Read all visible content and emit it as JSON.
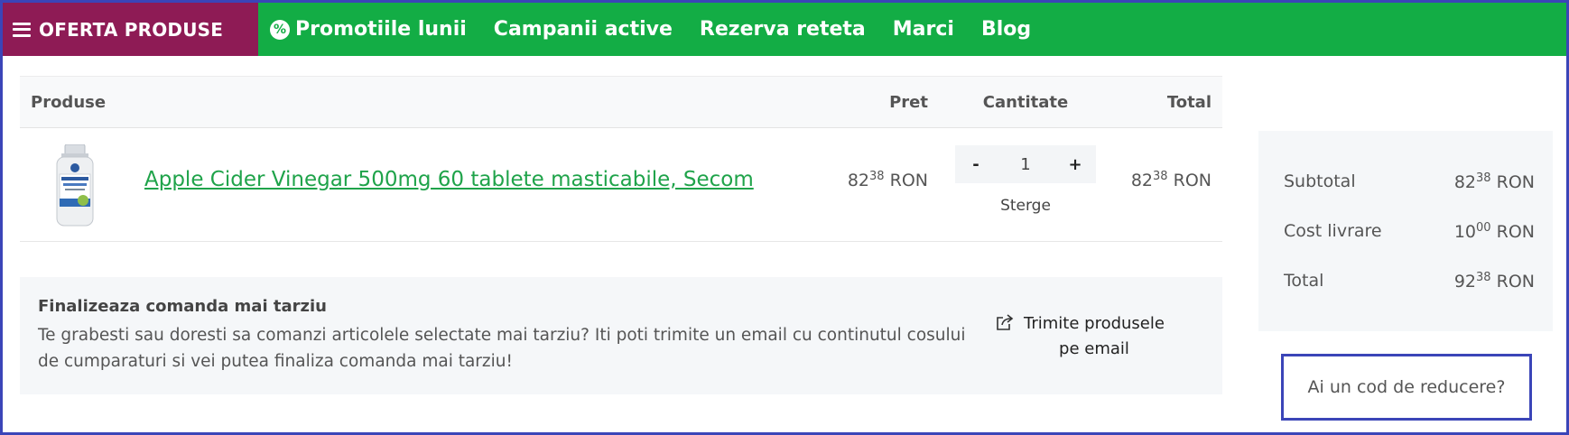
{
  "nav": {
    "offer_label": "OFERTA PRODUSE",
    "links": [
      "Promotiile lunii",
      "Campanii active",
      "Rezerva reteta",
      "Marci",
      "Blog"
    ],
    "promo_icon_glyph": "%"
  },
  "cart": {
    "headers": {
      "product": "Produse",
      "price": "Pret",
      "quantity": "Cantitate",
      "total": "Total"
    },
    "items": [
      {
        "name": "Apple Cider Vinegar 500mg 60 tablete masticabile, Secom",
        "image_label": "Apple Cider Vinegar",
        "price_int": "82",
        "price_dec": "38",
        "currency": "RON",
        "quantity": "1",
        "minus": "-",
        "plus": "+",
        "remove_label": "Sterge",
        "total_int": "82",
        "total_dec": "38"
      }
    ]
  },
  "later": {
    "title": "Finalizeaza comanda mai tarziu",
    "text": "Te grabesti sau doresti sa comanzi articolele selectate mai tarziu? Iti poti trimite un email cu continutul cosului de cumparaturi si vei putea finaliza comanda mai tarziu!",
    "send_label_1": "Trimite produsele",
    "send_label_2": "pe email"
  },
  "summary": {
    "subtotal_label": "Subtotal",
    "subtotal_int": "82",
    "subtotal_dec": "38",
    "shipping_label": "Cost livrare",
    "shipping_int": "10",
    "shipping_dec": "00",
    "total_label": "Total",
    "total_int": "92",
    "total_dec": "38",
    "currency": "RON"
  },
  "coupon": {
    "label": "Ai un cod de reducere?"
  },
  "colors": {
    "nav_green": "#13ad45",
    "offer_purple": "#8e1b55",
    "link_green": "#1fa34a",
    "highlight_blue": "#3b45b8"
  }
}
